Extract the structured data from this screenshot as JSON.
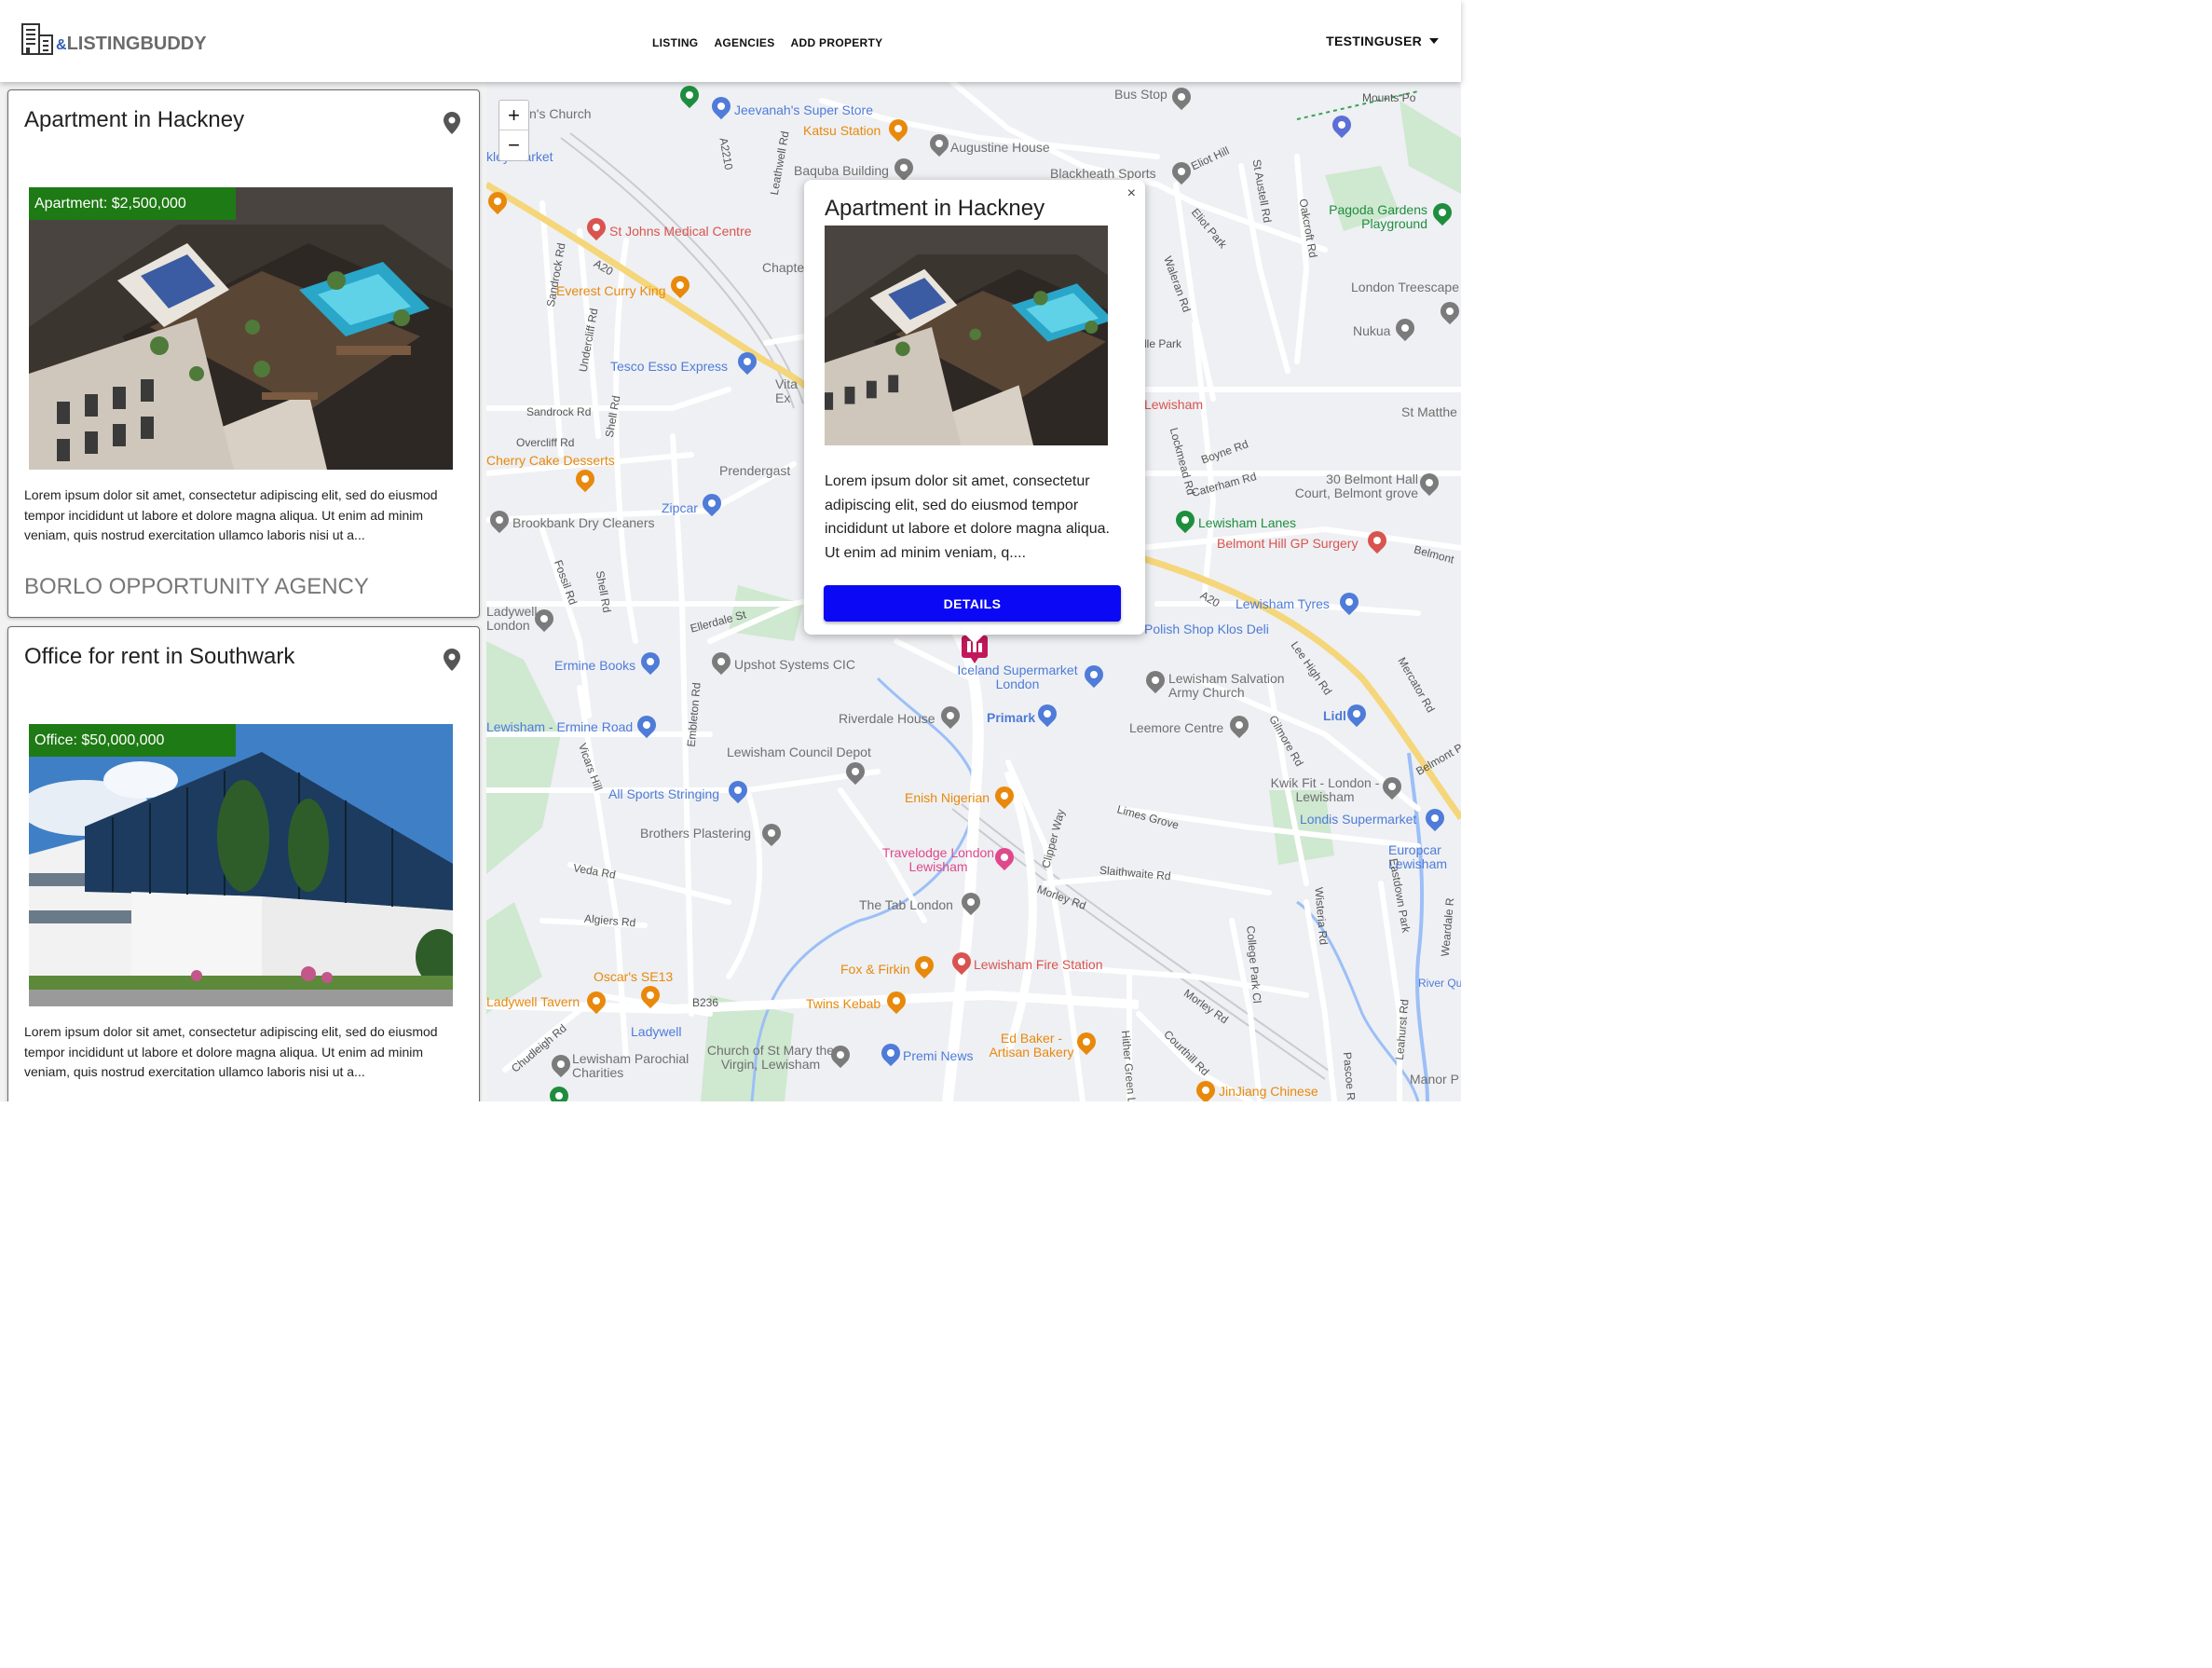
{
  "header": {
    "logo_amp": "&",
    "logo_text": "LISTINGBUDDY",
    "nav": [
      "LISTING",
      "AGENCIES",
      "ADD PROPERTY"
    ],
    "user": "TESTINGUSER"
  },
  "listings": [
    {
      "title": "Apartment in Hackney",
      "price_tag": "Apartment: $2,500,000",
      "description": "Lorem ipsum dolor sit amet, consectetur adipiscing elit, sed do eiusmod tempor incididunt ut labore et dolore magna aliqua. Ut enim ad minim veniam, quis nostrud exercitation ullamco laboris nisi ut a...",
      "agency": "BORLO OPPORTUNITY AGENCY"
    },
    {
      "title": "Office for rent in Southwark",
      "price_tag": "Office: $50,000,000",
      "description": "Lorem ipsum dolor sit amet, consectetur adipiscing elit, sed do eiusmod tempor incididunt ut labore et dolore magna aliqua. Ut enim ad minim veniam, quis nostrud exercitation ullamco laboris nisi ut a..."
    }
  ],
  "map": {
    "zoom_in": "+",
    "zoom_out": "−",
    "popup": {
      "close": "×",
      "title": "Apartment in Hackney",
      "description": "Lorem ipsum dolor sit amet, consectetur adipiscing elit, sed do eiusmod tempor incididunt ut labore et dolore magna aliqua. Ut enim ad minim veniam, q....",
      "button": "DETAILS"
    },
    "pois": [
      {
        "label": "Jeevanah's Super Store",
        "color": "#4f7bd9"
      },
      {
        "label": "Katsu Station",
        "color": "#e8890c"
      },
      {
        "label": "Augustine House",
        "color": "#6f6f6f"
      },
      {
        "label": "Baquba Building",
        "color": "#6f6f6f"
      },
      {
        "label": "Blackheath Sports",
        "color": "#6f6f6f"
      },
      {
        "label": "Bus Stop",
        "color": "#6f6f6f"
      },
      {
        "label": "St Johns Medical Centre",
        "color": "#d9534f"
      },
      {
        "label": "Everest Curry King",
        "color": "#e8890c"
      },
      {
        "label": "Tesco Esso Express",
        "color": "#4f7bd9"
      },
      {
        "label": "Pagoda Gardens Playground",
        "color": "#1e8e3e"
      },
      {
        "label": "London Treescape",
        "color": "#6f6f6f"
      },
      {
        "label": "Nukua",
        "color": "#6f6f6f"
      },
      {
        "label": "Sandrock Rd",
        "color": "#555555"
      },
      {
        "label": "Overcliff Rd",
        "color": "#555555"
      },
      {
        "label": "Cherry Cake Desserts",
        "color": "#e8890c"
      },
      {
        "label": "Zipcar",
        "color": "#4f7bd9"
      },
      {
        "label": "Prendergast",
        "color": "#6f6f6f"
      },
      {
        "label": "Brookbank Dry Cleaners",
        "color": "#6f6f6f"
      },
      {
        "label": "30 Belmont Hall Court, Belmont grove",
        "color": "#6f6f6f"
      },
      {
        "label": "Lewisham Lanes",
        "color": "#1e8e3e"
      },
      {
        "label": "Belmont Hill GP Surgery",
        "color": "#d9534f"
      },
      {
        "label": "Lewisham Tyres",
        "color": "#4f7bd9"
      },
      {
        "label": "Polish Shop Klos Deli",
        "color": "#4f7bd9"
      },
      {
        "label": "Ermine Books",
        "color": "#4f7bd9"
      },
      {
        "label": "Upshot Systems CIC",
        "color": "#6f6f6f"
      },
      {
        "label": "Iceland Supermarket London",
        "color": "#4f7bd9"
      },
      {
        "label": "Lewisham Salvation Army Church",
        "color": "#6f6f6f"
      },
      {
        "label": "Riverdale House",
        "color": "#6f6f6f"
      },
      {
        "label": "Primark",
        "color": "#4f7bd9"
      },
      {
        "label": "Leemore Centre",
        "color": "#6f6f6f"
      },
      {
        "label": "Lidl",
        "color": "#4f7bd9"
      },
      {
        "label": "Lewisham - Ermine Road",
        "color": "#4f7bd9"
      },
      {
        "label": "Lewisham Council Depot",
        "color": "#6f6f6f"
      },
      {
        "label": "All Sports Stringing",
        "color": "#4f7bd9"
      },
      {
        "label": "Enish Nigerian",
        "color": "#e8890c"
      },
      {
        "label": "Kwik Fit - London - Lewisham",
        "color": "#6f6f6f"
      },
      {
        "label": "Londis Supermarket",
        "color": "#4f7bd9"
      },
      {
        "label": "Brothers Plastering",
        "color": "#6f6f6f"
      },
      {
        "label": "Travelodge London Lewisham",
        "color": "#e0488b"
      },
      {
        "label": "The Tab London",
        "color": "#6f6f6f"
      },
      {
        "label": "Europcar Lewisham",
        "color": "#4f7bd9"
      },
      {
        "label": "Fox & Firkin",
        "color": "#e8890c"
      },
      {
        "label": "Lewisham Fire Station",
        "color": "#d9534f"
      },
      {
        "label": "Oscar's SE13",
        "color": "#e8890c"
      },
      {
        "label": "Twins Kebab",
        "color": "#e8890c"
      },
      {
        "label": "Ladywell Tavern",
        "color": "#e8890c"
      },
      {
        "label": "Ladywell",
        "color": "#4f7bd9"
      },
      {
        "label": "Church of St Mary the Virgin, Lewisham",
        "color": "#6f6f6f"
      },
      {
        "label": "Premi News",
        "color": "#4f7bd9"
      },
      {
        "label": "Ed Baker - Artisan Bakery",
        "color": "#e8890c"
      },
      {
        "label": "Lewisham Parochial Charities",
        "color": "#6f6f6f"
      },
      {
        "label": "JinJiang Chinese",
        "color": "#e8890c"
      },
      {
        "label": "Ladywell London",
        "color": "#6f6f6f"
      },
      {
        "label": "Vita Ex",
        "color": "#6f6f6f"
      },
      {
        "label": "St Matthe",
        "color": "#6f6f6f"
      },
      {
        "label": "Manor P",
        "color": "#6f6f6f"
      },
      {
        "label": "Mounts Po",
        "color": "#6f6f6f"
      },
      {
        "label": "n's Church",
        "color": "#6f6f6f"
      },
      {
        "label": "kley Market",
        "color": "#4f7bd9"
      },
      {
        "label": "Chapte",
        "color": "#6f6f6f"
      },
      {
        "label": "Lewisham",
        "color": "#d9534f"
      },
      {
        "label": "lle Park",
        "color": "#6f6f6f"
      },
      {
        "label": "River Quaggy",
        "color": "#4f7bd9"
      }
    ],
    "roads": [
      "A2210",
      "Leathwell Rd",
      "A20",
      "Sandrock Rd",
      "Undercliff Rd",
      "Shell Rd",
      "Sandrock Rd",
      "Overcliff Rd",
      "Fossil Rd",
      "Shell Rd",
      "Ellerdale St",
      "Embleton Rd",
      "Vicars Hill",
      "Veda Rd",
      "Algiers Rd",
      "B236",
      "Chudleigh Rd",
      "Eliot Hill",
      "St Austell Rd",
      "Oakcroft Rd",
      "Eliot Park",
      "Waleran Rd",
      "Lockmead Rd",
      "Boyne Rd",
      "Caterham Rd",
      "Belmont",
      "A20",
      "Lee High Rd",
      "Mercator Rd",
      "Gilmore Rd",
      "Limes Grove",
      "Slaithwaite Rd",
      "Clipper Way",
      "Morley Rd",
      "Wisteria Rd",
      "Eastdown Park",
      "College Park Cl",
      "Morley Rd",
      "Courthill Rd",
      "Hither Green L",
      "Leahurst Rd",
      "Pascoe R",
      "Weardale R",
      "Belmont P"
    ]
  }
}
